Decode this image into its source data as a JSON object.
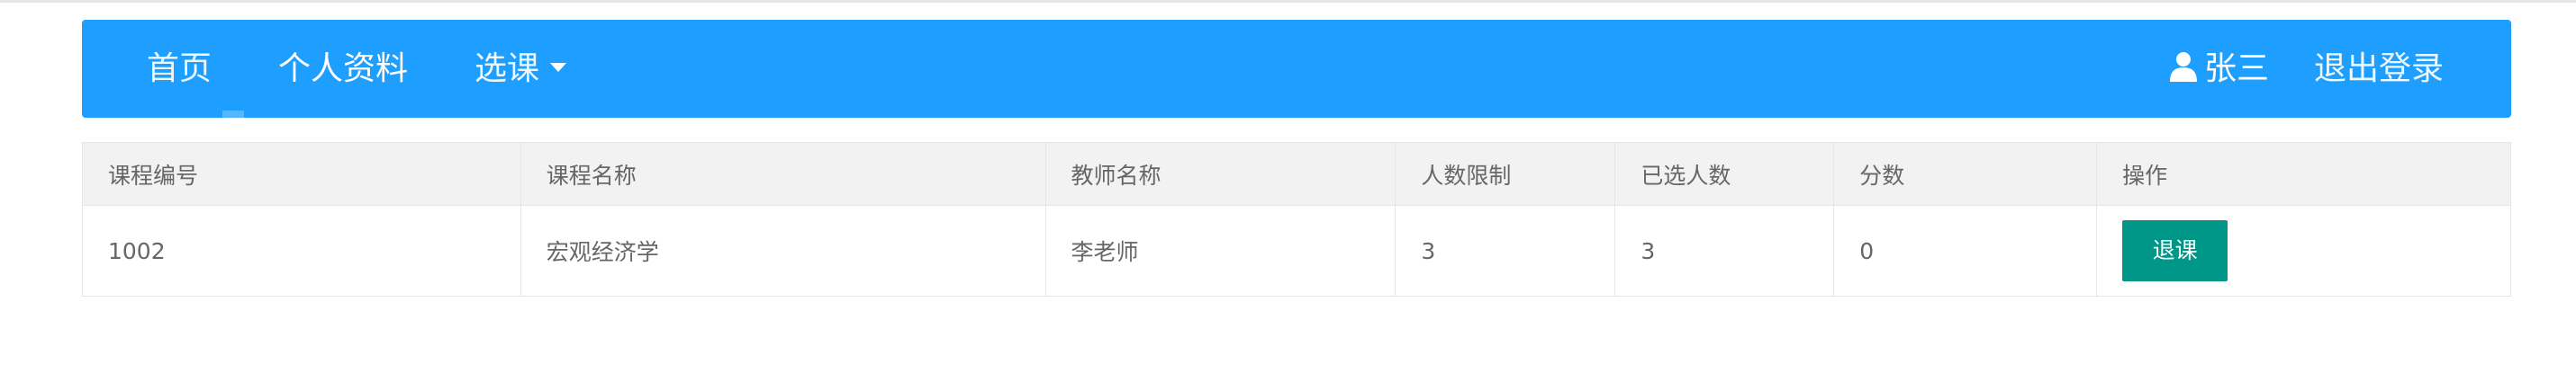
{
  "navbar": {
    "home_label": "首页",
    "profile_label": "个人资料",
    "course_label": "选课",
    "user_name": "张三",
    "logout_label": "退出登录"
  },
  "table": {
    "headers": [
      "课程编号",
      "课程名称",
      "教师名称",
      "人数限制",
      "已选人数",
      "分数",
      "操作"
    ],
    "rows": [
      {
        "course_id": "1002",
        "course_name": "宏观经济学",
        "teacher": "李老师",
        "limit": "3",
        "enrolled": "3",
        "score": "0",
        "action_label": "退课"
      }
    ]
  },
  "colors": {
    "navbar_bg": "#1e9fff",
    "header_bg": "#f2f2f2",
    "button_bg": "#009688"
  },
  "icons": {
    "user": "user-icon",
    "dropdown": "caret-down-icon"
  }
}
